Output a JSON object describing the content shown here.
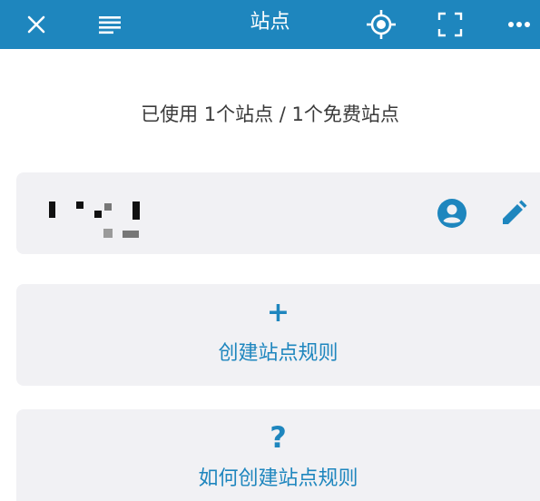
{
  "header": {
    "title": "站点",
    "icons": {
      "close": "close-icon",
      "menu": "menu-icon",
      "locate": "locate-icon",
      "scan": "scan-icon",
      "more": "more-icon"
    },
    "background_color": "#1e86be"
  },
  "usage_text": "已使用 1个站点 / 1个免费站点",
  "site_card": {
    "name_redacted": true,
    "icons": {
      "account": "account-icon",
      "edit": "edit-icon"
    }
  },
  "create_rule": {
    "symbol": "+",
    "label": "创建站点规则"
  },
  "howto": {
    "symbol": "?",
    "label": "如何创建站点规则"
  },
  "accent_color": "#1e86be"
}
